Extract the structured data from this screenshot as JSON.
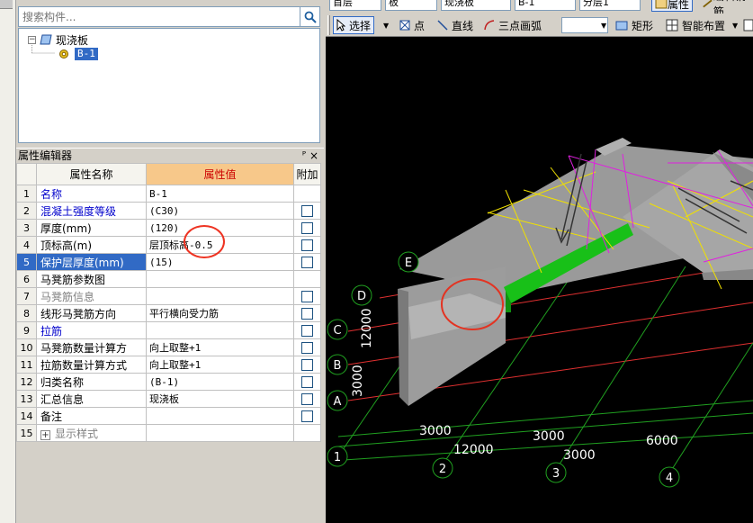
{
  "search": {
    "placeholder": "搜索构件..."
  },
  "tree": {
    "root": {
      "label": "现浇板"
    },
    "child": {
      "label": "B-1"
    }
  },
  "editor": {
    "title": "属性编辑器",
    "pin": "ᴾ",
    "close": "×",
    "columns": {
      "name": "属性名称",
      "value": "属性值",
      "extra": "附加"
    },
    "rows": [
      {
        "num": "1",
        "name": "名称",
        "value": "B-1"
      },
      {
        "num": "2",
        "name": "混凝土强度等级",
        "value": "(C30)"
      },
      {
        "num": "3",
        "name": "厚度(mm)",
        "value": "(120)"
      },
      {
        "num": "4",
        "name": "顶标高(m)",
        "value": "层顶标高-0.5"
      },
      {
        "num": "5",
        "name": "保护层厚度(mm)",
        "value": "(15)"
      },
      {
        "num": "6",
        "name": "马凳筋参数图",
        "value": ""
      },
      {
        "num": "7",
        "name": "马凳筋信息",
        "value": ""
      },
      {
        "num": "8",
        "name": "线形马凳筋方向",
        "value": "平行横向受力筋"
      },
      {
        "num": "9",
        "name": "拉筋",
        "value": ""
      },
      {
        "num": "10",
        "name": "马凳筋数量计算方",
        "value": "向上取整+1"
      },
      {
        "num": "11",
        "name": "拉筋数量计算方式",
        "value": "向上取整+1"
      },
      {
        "num": "12",
        "name": "归类名称",
        "value": "(B-1)"
      },
      {
        "num": "13",
        "name": "汇总信息",
        "value": "现浇板"
      },
      {
        "num": "14",
        "name": "备注",
        "value": ""
      },
      {
        "num": "15",
        "name": "显示样式",
        "value": ""
      }
    ]
  },
  "toolbar_top": {
    "floor": "首层",
    "category": "板",
    "type": "现浇板",
    "element": "B-1",
    "layer": "分层1",
    "properties": "属性",
    "edit_rebar": "编辑钢筋"
  },
  "toolbar": {
    "select": "选择",
    "point": "点",
    "line": "直线",
    "arc": "三点画弧",
    "rect": "矩形",
    "smart": "智能布置"
  },
  "axes": {
    "rows": [
      "E",
      "D",
      "C",
      "B",
      "A"
    ],
    "cols": [
      "1",
      "2",
      "3",
      "4"
    ],
    "dims": [
      "12000",
      "3000",
      "3000",
      "3000",
      "6000",
      "12000",
      "3000"
    ]
  },
  "colors": {
    "selection": "#316ac5",
    "header_value_bg": "#f7c88a",
    "highlight_circle": "#e33322",
    "grid_red": "#e03030",
    "grid_green": "#20a020",
    "rebar_yellow": "#f0e000",
    "rebar_magenta": "#e020e0",
    "beam_green": "#18c018"
  }
}
